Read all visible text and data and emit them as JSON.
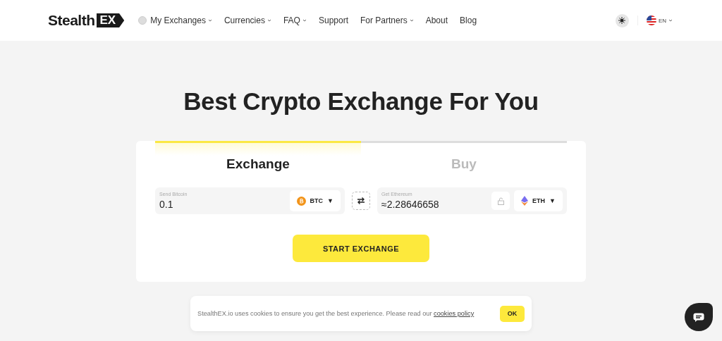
{
  "logo": {
    "text": "Stealth",
    "badge": "EX"
  },
  "nav": [
    {
      "label": "My Exchanges",
      "dropdown": true,
      "icon": true
    },
    {
      "label": "Currencies",
      "dropdown": true,
      "icon": false
    },
    {
      "label": "FAQ",
      "dropdown": true,
      "icon": false
    },
    {
      "label": "Support",
      "dropdown": false,
      "icon": false
    },
    {
      "label": "For Partners",
      "dropdown": true,
      "icon": false
    },
    {
      "label": "About",
      "dropdown": false,
      "icon": false
    },
    {
      "label": "Blog",
      "dropdown": false,
      "icon": false
    }
  ],
  "language": "EN",
  "hero": {
    "title": "Best Crypto Exchange For You"
  },
  "tabs": [
    {
      "label": "Exchange",
      "selected": true
    },
    {
      "label": "Buy",
      "selected": false
    }
  ],
  "send": {
    "label": "Send Bitcoin",
    "value": "0.1",
    "currency": "BTC",
    "caret": "▼"
  },
  "get": {
    "label": "Get Ethereum",
    "value": "≈2.28646658",
    "currency": "ETH",
    "caret": "▼"
  },
  "start_button": "START EXCHANGE",
  "cookie": {
    "text": "StealthEX.io uses cookies to ensure you get the best experience. Please read our",
    "link": "cookies policy",
    "button": "OK"
  }
}
